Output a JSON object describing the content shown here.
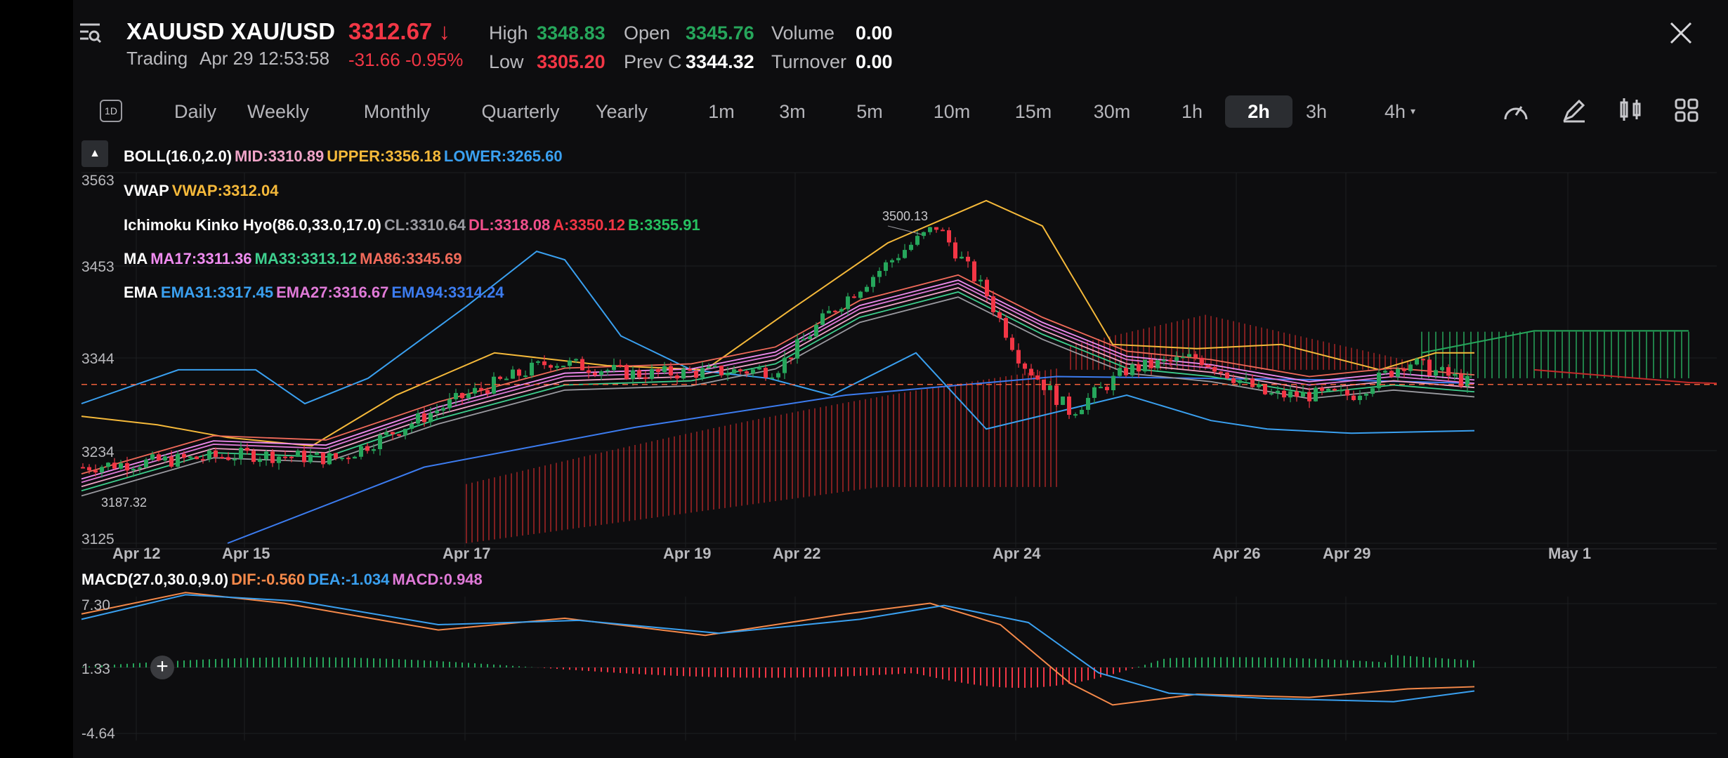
{
  "header": {
    "symbol": "XAUUSD XAU/USD",
    "price": "3312.67",
    "status": "Trading",
    "time": "Apr 29 12:53:58",
    "change": "-31.66 -0.95%",
    "high_label": "High",
    "high": "3348.83",
    "low_label": "Low",
    "low": "3305.20",
    "open_label": "Open",
    "open": "3345.76",
    "prevc_label": "Prev C",
    "prevc": "3344.32",
    "volume_label": "Volume",
    "volume": "0.00",
    "turnover_label": "Turnover",
    "turnover": "0.00"
  },
  "toolbar": {
    "period_icon_text": "1D",
    "tabs": [
      "Daily",
      "Weekly",
      "Monthly",
      "Quarterly",
      "Yearly",
      "1m",
      "3m",
      "5m",
      "10m",
      "15m",
      "30m",
      "1h",
      "2h",
      "3h",
      "4h"
    ],
    "active_tab": "2h"
  },
  "indicators": {
    "boll": {
      "name": "BOLL(16.0,2.0)",
      "mid": "MID:3310.89",
      "upper": "UPPER:3356.18",
      "lower": "LOWER:3265.60"
    },
    "vwap": {
      "name": "VWAP",
      "value": "VWAP:3312.04"
    },
    "ichimoku": {
      "name": "Ichimoku Kinko Hyo(86.0,33.0,17.0)",
      "cl": "CL:3310.64",
      "dl": "DL:3318.08",
      "a": "A:3350.12",
      "b": "B:3355.91"
    },
    "ma": {
      "name": "MA",
      "ma17": "MA17:3311.36",
      "ma33": "MA33:3313.12",
      "ma86": "MA86:3345.69"
    },
    "ema": {
      "name": "EMA",
      "ema31": "EMA31:3317.45",
      "ema27": "EMA27:3316.67",
      "ema94": "EMA94:3314.24"
    },
    "macd": {
      "name": "MACD(27.0,30.0,9.0)",
      "dif": "DIF:-0.560",
      "dea": "DEA:-1.034",
      "macd": "MACD:0.948"
    }
  },
  "price_axis": [
    "3563",
    "3453",
    "3344",
    "3234",
    "3125"
  ],
  "macd_axis": [
    "7.30",
    "1.33",
    "-4.64"
  ],
  "annotations": {
    "high_mark": "3500.13",
    "low_mark": "3187.32"
  },
  "time_axis": [
    "Apr 12",
    "Apr 15",
    "Apr 17",
    "Apr 19",
    "Apr 22",
    "Apr 24",
    "Apr 26",
    "Apr 29",
    "May 1"
  ],
  "colors": {
    "up": "#26a65b",
    "down": "#f23645",
    "boll_mid": "#f0a4c8",
    "boll_upper": "#f5b93a",
    "boll_lower": "#3aa0f0",
    "vwap": "#f5b93a",
    "ma17": "#f08cf0",
    "ma33": "#3ecf8e",
    "ma86": "#f06a5a",
    "ema31": "#3aa0f0",
    "ema27": "#e07ad8",
    "ema94": "#3c7cf0",
    "dif": "#f5894a",
    "dea": "#3aa0f0",
    "macd": "#e07ad8"
  }
}
